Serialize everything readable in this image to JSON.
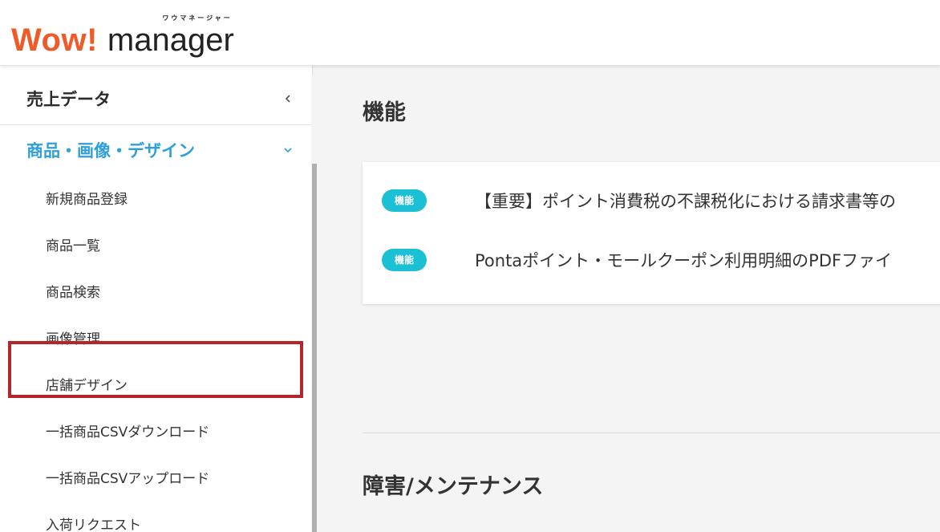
{
  "header": {
    "logo_wow": "Wow!",
    "logo_manager": "manager",
    "logo_kana": "ワウマネージャー"
  },
  "sidebar": {
    "categories": [
      {
        "label": "売上データ",
        "state": "collapsed"
      },
      {
        "label": "商品・画像・デザイン",
        "state": "expanded"
      }
    ],
    "items": [
      {
        "label": "新規商品登録"
      },
      {
        "label": "商品一覧"
      },
      {
        "label": "商品検索"
      },
      {
        "label": "画像管理"
      },
      {
        "label": "店舗デザイン"
      },
      {
        "label": "一括商品CSVダウンロード",
        "highlighted": true
      },
      {
        "label": "一括商品CSVアップロード"
      },
      {
        "label": "入荷リクエスト"
      }
    ],
    "active_color": "#2d9fde"
  },
  "main": {
    "section1_title": "機能",
    "news": [
      {
        "badge": "機能",
        "text": "【重要】ポイント消費税の不課税化における請求書等の"
      },
      {
        "badge": "機能",
        "text": "Pontaポイント・モールクーポン利用明細のPDFファイ"
      }
    ],
    "section2_title": "障害/メンテナンス"
  },
  "colors": {
    "brand_orange": "#f05a28",
    "badge_cyan": "#1bc0d5",
    "highlight_red": "#b3262b"
  }
}
